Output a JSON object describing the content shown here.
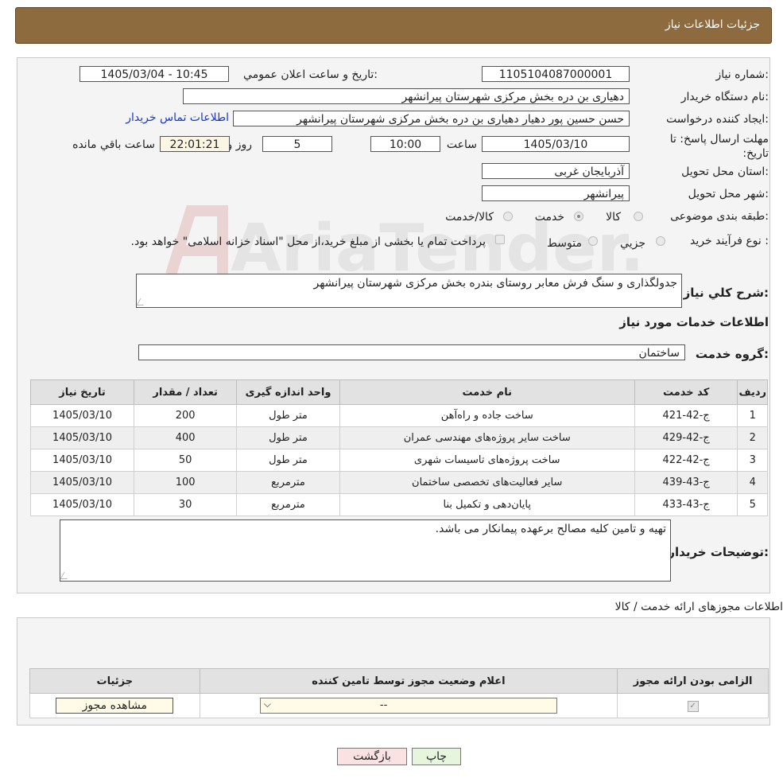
{
  "header": {
    "title": "جزئیات اطلاعات نیاز"
  },
  "labels": {
    "need_number": "شماره نیاز:",
    "announce_datetime": "تاریخ و ساعت اعلان عمومي:",
    "buyer_org": "نام دستگاه خریدار:",
    "requester": "ایجاد کننده درخواست:",
    "deadline": "مهلت ارسال پاسخ: تا تاریخ:",
    "time_word": "ساعت",
    "day_word": "روز و",
    "remaining": "ساعت باقي مانده",
    "delivery_province": "استان محل تحویل:",
    "delivery_city": "شهر محل تحویل:",
    "category": "طبقه بندی موضوعی:",
    "purchase_type": "نوع فرآیند خرید :",
    "general_desc": "شرح کلي نیاز:",
    "services_info": "اطلاعات خدمات مورد نیاز",
    "service_group": "گروه خدمت:",
    "buyer_notes": "توضیحات خریدار:",
    "permits_title": "اطلاعات مجوزهای ارائه خدمت / کالا"
  },
  "values": {
    "need_number": "1105104087000001",
    "announce_datetime": "1405/03/04 - 10:45",
    "buyer_org": "دهیاری بن دره بخش مرکزی شهرستان پیرانشهر",
    "requester": "حسن حسین پور دهیار دهیاری بن دره بخش مرکزی شهرستان پیرانشهر",
    "contact_link": "اطلاعات تماس خریدار",
    "deadline_date": "1405/03/10",
    "deadline_time": "10:00",
    "days": "5",
    "remaining_time": "22:01:21",
    "delivery_province": "آذربایجان غربی",
    "delivery_city": "پیرانشهر",
    "general_desc": "جدولگذاری و سنگ فرش معابر روستای بندره بخش مرکزی شهرستان پیرانشهر",
    "service_group": "ساختمان",
    "buyer_notes": "تهیه و تامین کلیه مصالح برعهده پیمانکار می باشد."
  },
  "category_options": [
    {
      "label": "کالا",
      "selected": false
    },
    {
      "label": "خدمت",
      "selected": true
    },
    {
      "label": "کالا/خدمت",
      "selected": false
    }
  ],
  "purchase_options": [
    {
      "label": "جزیي",
      "selected": false
    },
    {
      "label": "متوسط",
      "selected": false
    }
  ],
  "purchase_note": "پرداخت تمام یا بخشی از مبلغ خرید،از محل \"اسناد خزانه اسلامی\" خواهد بود.",
  "services_table": {
    "headers": [
      "ردیف",
      "کد خدمت",
      "نام خدمت",
      "واحد اندازه گیری",
      "تعداد / مقدار",
      "تاریخ نیاز"
    ],
    "rows": [
      [
        "1",
        "ج-42-421",
        "ساخت جاده و راه‌آهن",
        "متر طول",
        "200",
        "1405/03/10"
      ],
      [
        "2",
        "ج-42-429",
        "ساخت سایر پروژه‌های مهندسی عمران",
        "متر طول",
        "400",
        "1405/03/10"
      ],
      [
        "3",
        "ج-42-422",
        "ساخت پروژه‌های تاسیسات شهری",
        "متر طول",
        "50",
        "1405/03/10"
      ],
      [
        "4",
        "ج-43-439",
        "سایر فعالیت‌های تخصصی ساختمان",
        "مترمربع",
        "100",
        "1405/03/10"
      ],
      [
        "5",
        "ج-43-433",
        "پایان‌دهی و تکمیل بنا",
        "مترمربع",
        "30",
        "1405/03/10"
      ]
    ]
  },
  "permits_table": {
    "headers": [
      "الزامی بودن ارائه مجوز",
      "اعلام وضعیت مجوز توسط تامین کننده",
      "جزئیات"
    ],
    "select_value": "--",
    "view_button": "مشاهده مجوز",
    "required_checked": true
  },
  "buttons": {
    "print": "چاپ",
    "back": "بازگشت"
  },
  "watermark": {
    "text": "AriaTender.neT",
    "color": "#e6cfcf"
  },
  "colors": {
    "header_bg": "#8e6b3f",
    "link": "#1a37c9",
    "print_bg": "#e6f6dd",
    "back_bg": "#fbe2e2"
  }
}
